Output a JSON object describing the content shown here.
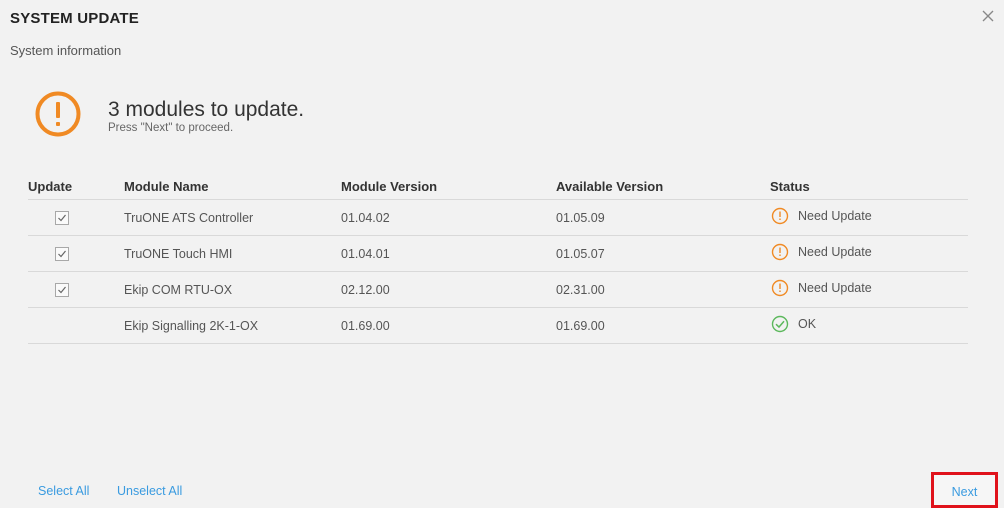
{
  "dialog": {
    "title": "SYSTEM UPDATE",
    "subtitle": "System information",
    "close_icon": "close-icon"
  },
  "summary": {
    "icon": "warning-circle-icon",
    "headline": "3 modules to update.",
    "hint": "Press \"Next\" to proceed."
  },
  "table": {
    "headers": {
      "update": "Update",
      "module_name": "Module Name",
      "module_version": "Module Version",
      "available_version": "Available Version",
      "status": "Status"
    },
    "rows": [
      {
        "checked": true,
        "module_name": "TruONE ATS Controller",
        "module_version": "01.04.02",
        "available_version": "01.05.09",
        "status": "Need Update",
        "status_icon": "warning-circle-icon"
      },
      {
        "checked": true,
        "module_name": "TruONE Touch HMI",
        "module_version": "01.04.01",
        "available_version": "01.05.07",
        "status": "Need Update",
        "status_icon": "warning-circle-icon"
      },
      {
        "checked": true,
        "module_name": "Ekip COM RTU-OX",
        "module_version": "02.12.00",
        "available_version": "02.31.00",
        "status": "Need Update",
        "status_icon": "warning-circle-icon"
      },
      {
        "checked": false,
        "module_name": "Ekip Signalling 2K-1-OX",
        "module_version": "01.69.00",
        "available_version": "01.69.00",
        "status": "OK",
        "status_icon": "check-circle-icon"
      }
    ]
  },
  "footer": {
    "select_all": "Select All",
    "unselect_all": "Unselect All",
    "next": "Next"
  },
  "colors": {
    "warning": "#f08a24",
    "ok": "#5cb85c",
    "link": "#3a9be0",
    "highlight": "#e0121b"
  }
}
